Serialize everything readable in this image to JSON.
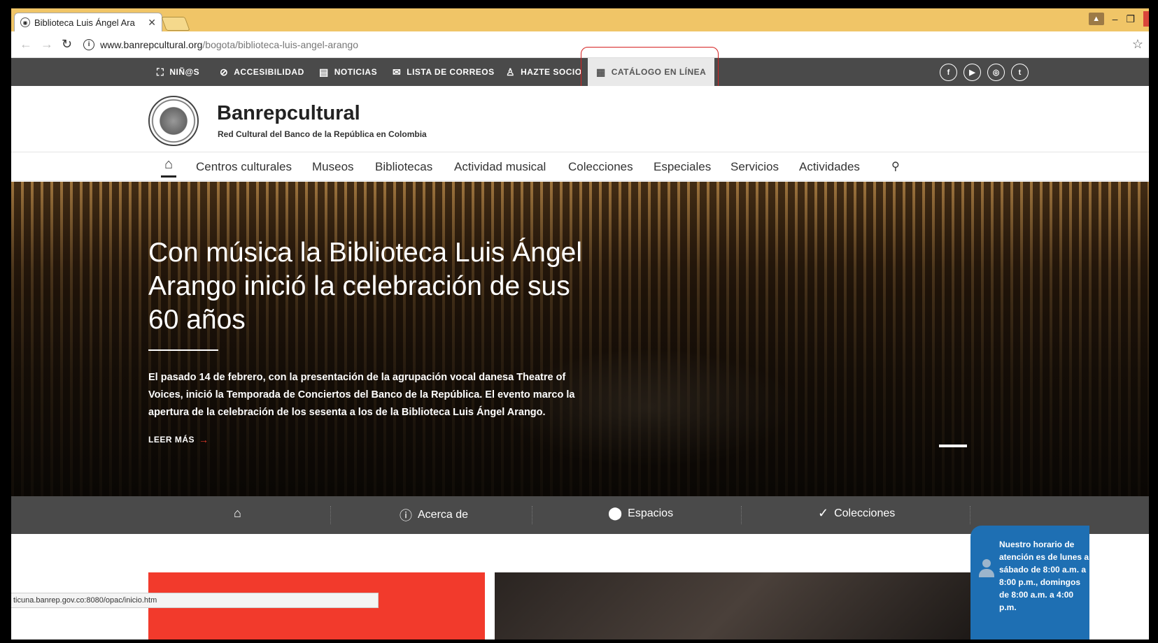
{
  "browser": {
    "tab_title": "Biblioteca Luis Ángel Ara",
    "url_domain": "www.banrepcultural.org",
    "url_path": "/bogota/biblioteca-luis-angel-arango",
    "status_url": "ticuna.banrep.gov.co:8080/opac/inicio.htm"
  },
  "utility_bar": {
    "items": [
      {
        "label": "NIÑ@S",
        "icon": "children-icon"
      },
      {
        "label": "ACCESIBILIDAD",
        "icon": "accessibility-icon"
      },
      {
        "label": "NOTICIAS",
        "icon": "news-icon"
      },
      {
        "label": "LISTA DE CORREOS",
        "icon": "mail-icon"
      },
      {
        "label": "HAZTE SOCIO",
        "icon": "user-icon"
      },
      {
        "label": "CATÁLOGO EN LÍNEA",
        "icon": "catalog-icon"
      }
    ],
    "social": [
      "facebook-icon",
      "youtube-icon",
      "instagram-icon",
      "twitter-icon"
    ]
  },
  "brand": {
    "name": "Banrepcultural",
    "subtitle": "Red Cultural del Banco de la República en Colombia"
  },
  "main_nav": {
    "items": [
      "Centros culturales",
      "Museos",
      "Bibliotecas",
      "Actividad musical",
      "Colecciones",
      "Especiales",
      "Servicios",
      "Actividades"
    ]
  },
  "hero": {
    "title": "Con música la Biblioteca Luis Ángel Arango inició la celebración de sus 60 años",
    "text": "El pasado 14 de febrero, con la presentación de la agrupación vocal danesa Theatre of Voices, inició la Temporada de Conciertos del Banco de la República. El evento marco la apertura de la celebración de los sesenta a los de la Biblioteca Luis Ángel Arango.",
    "read_more": "LEER MÁS"
  },
  "section_nav": {
    "items": [
      {
        "label": "",
        "icon": "home-icon"
      },
      {
        "label": "Acerca de",
        "icon": "info-icon"
      },
      {
        "label": "Espacios",
        "icon": "location-pin-icon"
      },
      {
        "label": "Colecciones",
        "icon": "checkmark-icon"
      }
    ]
  },
  "hours_widget": {
    "text": "Nuestro horario de atención es de lunes a sábado de 8:00 a.m. a 8:00 p.m., domingos de 8:00 a.m. a 4:00 p.m."
  },
  "colors": {
    "utility_bg": "#4a4a4a",
    "accent_red": "#f23a2c",
    "widget_blue": "#1e6fb3",
    "tabstrip": "#f0c567"
  }
}
